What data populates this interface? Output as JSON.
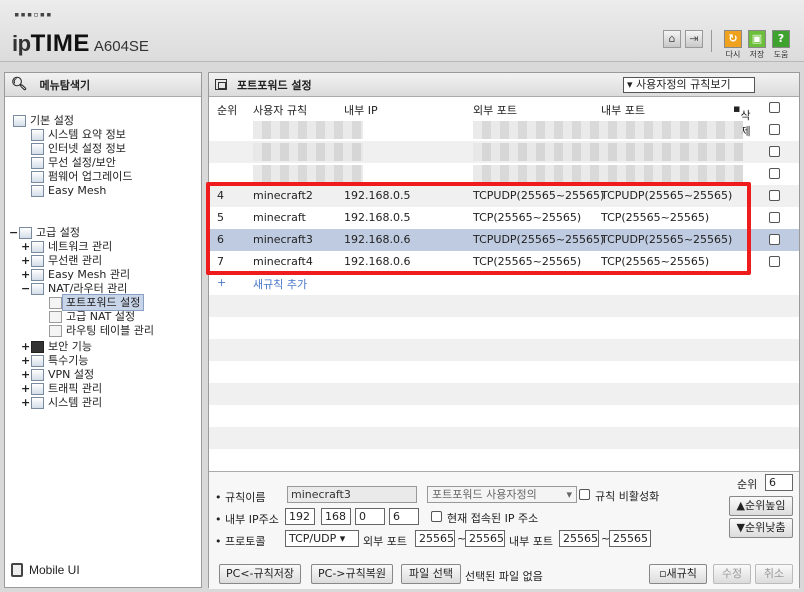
{
  "header": {
    "logo_prefix": "ip",
    "logo_brand": "TIME",
    "model": "A604SE",
    "dots": "▪▪▪▫▪▪",
    "icons": [
      "home-icon",
      "logout-icon",
      "refresh-icon",
      "save-icon",
      "help-icon"
    ],
    "refresh_label": "다시",
    "save_label": "저장",
    "help_label": "도움"
  },
  "menu": {
    "title": "메뉴탐색기",
    "basic": "기본 설정",
    "summary": "시스템 요약 정보",
    "internet": "인터넷 설정 정보",
    "wireless": "무선 설정/보안",
    "firmware": "펌웨어 업그레이드",
    "easymesh": "Easy Mesh",
    "advanced": "고급 설정",
    "network": "네트워크 관리",
    "wlan": "무선랜 관리",
    "easymesh_mgmt": "Easy Mesh 관리",
    "nat": "NAT/라우터 관리",
    "portforward": "포트포워드 설정",
    "advnat": "고급 NAT 설정",
    "routing": "라우팅 테이블 관리",
    "security": "보안 기능",
    "special": "특수기능",
    "vpn": "VPN 설정",
    "traffic": "트래픽 관리",
    "system": "시스템 관리",
    "mobile": "Mobile UI"
  },
  "panel": {
    "title": "포트포워드 설정",
    "view_select": "사용자정의 규칙보기",
    "columns": {
      "order": "순위",
      "user_rule": "사용자 규칙",
      "internal_ip": "내부 IP",
      "external_port": "외부 포트",
      "internal_port": "내부 포트",
      "delete": "삭제"
    },
    "rules": [
      {
        "order": "4",
        "name": "minecraft2",
        "ip": "192.168.0.5",
        "ext": "TCPUDP(25565~25565)",
        "int": "TCPUDP(25565~25565)"
      },
      {
        "order": "5",
        "name": "minecraft",
        "ip": "192.168.0.5",
        "ext": "TCP(25565~25565)",
        "int": "TCP(25565~25565)"
      },
      {
        "order": "6",
        "name": "minecraft3",
        "ip": "192.168.0.6",
        "ext": "TCPUDP(25565~25565)",
        "int": "TCPUDP(25565~25565)"
      },
      {
        "order": "7",
        "name": "minecraft4",
        "ip": "192.168.0.6",
        "ext": "TCP(25565~25565)",
        "int": "TCP(25565~25565)"
      }
    ],
    "add_rule": "새규칙 추가",
    "add_icon": "+"
  },
  "form": {
    "rule_name_label": "• 규칙이름",
    "rule_name_value": "minecraft3",
    "preset_select": "포트포워드 사용자정의",
    "disable_rule_label": "규칙 비활성화",
    "internal_ip_label": "• 내부 IP주소",
    "ip1": "192",
    "ip2": "168",
    "ip3": "0",
    "ip4": "6",
    "current_ip_label": "현재 접속된 IP 주소",
    "protocol_label": "• 프로토콜",
    "protocol_value": "TCP/UDP",
    "ext_port_label": "외부 포트",
    "ext_from": "25565",
    "ext_to": "25565",
    "int_port_label": "내부 포트",
    "int_from": "25565",
    "int_to": "25565",
    "tilde": "~",
    "order_label": "순위",
    "order_value": "6",
    "up_button": "▲순위높임",
    "down_button": "▼순위낮춤",
    "pc_save": "PC<-규칙저장",
    "pc_restore": "PC->규칙복원",
    "file_select": "파일 선택",
    "no_file": "선택된 파일 없음",
    "new_rule": "▫새규칙",
    "modify": "수정",
    "cancel": "취소"
  }
}
